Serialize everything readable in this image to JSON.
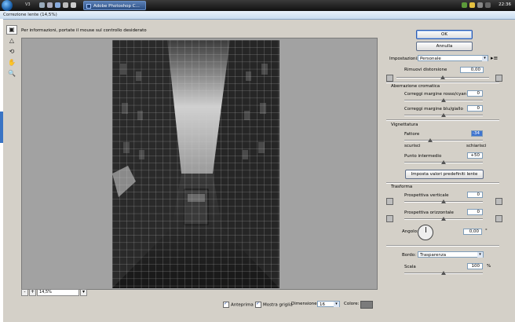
{
  "taskbar": {
    "small_label": "V3",
    "task": "Adobe Photoshop C...",
    "clock": "22:36"
  },
  "dialog": {
    "title": "Correzione lente (14,5%)",
    "info_text": "Per informazioni, portate il mouse sul controllo desiderato"
  },
  "preview": {
    "zoom_value": "14,5%",
    "zoom_minus": "-",
    "zoom_plus": "+"
  },
  "bottom_bar": {
    "preview_label": "Anteprima",
    "grid_label": "Mostra griglia",
    "size_label": "Dimensione:",
    "size_value": "16",
    "color_label": "Colore:",
    "grid_color": "#7b7b7b"
  },
  "buttons": {
    "ok": "OK",
    "cancel": "Annulla",
    "defaults": "Imposta valori predefiniti lente"
  },
  "settings": {
    "label": "Impostazioni:",
    "value": "Personale"
  },
  "distortion": {
    "label": "Rimuovi distorsione",
    "value": "0,00",
    "level": 0.5
  },
  "chromatic": {
    "heading": "Aberrazione cromatica",
    "red_cyan_label": "Correggi margine rosso/cyan",
    "red_cyan_value": "0",
    "red_cyan_level": 0.5,
    "blue_yellow_label": "Correggi margine blu/giallo",
    "blue_yellow_value": "0",
    "blue_yellow_level": 0.5
  },
  "vignette": {
    "heading": "Vignettatura",
    "amount_label": "Fattore",
    "amount_value": "-34",
    "amount_level": 0.33,
    "darker_label": "scurisci",
    "lighter_label": "schiarisci",
    "midpoint_label": "Punto intermedio",
    "midpoint_value": "+50",
    "midpoint_level": 0.5
  },
  "transform": {
    "heading": "Trasforma",
    "vertical_label": "Prospettiva verticale",
    "vertical_value": "0",
    "vertical_level": 0.5,
    "horizontal_label": "Prospettiva orizzontale",
    "horizontal_value": "0",
    "horizontal_level": 0.5,
    "angle_label": "Angolo:",
    "angle_value": "0,00",
    "angle_unit": "°"
  },
  "edge": {
    "label": "Bordo:",
    "value": "Trasparenza"
  },
  "scale": {
    "label": "Scala",
    "value": "100",
    "unit": "%",
    "level": 0.5
  },
  "colors": {
    "accent": "#3f75d0",
    "panel": "#d4d0c8",
    "preview_bg": "#a2a2a2"
  }
}
